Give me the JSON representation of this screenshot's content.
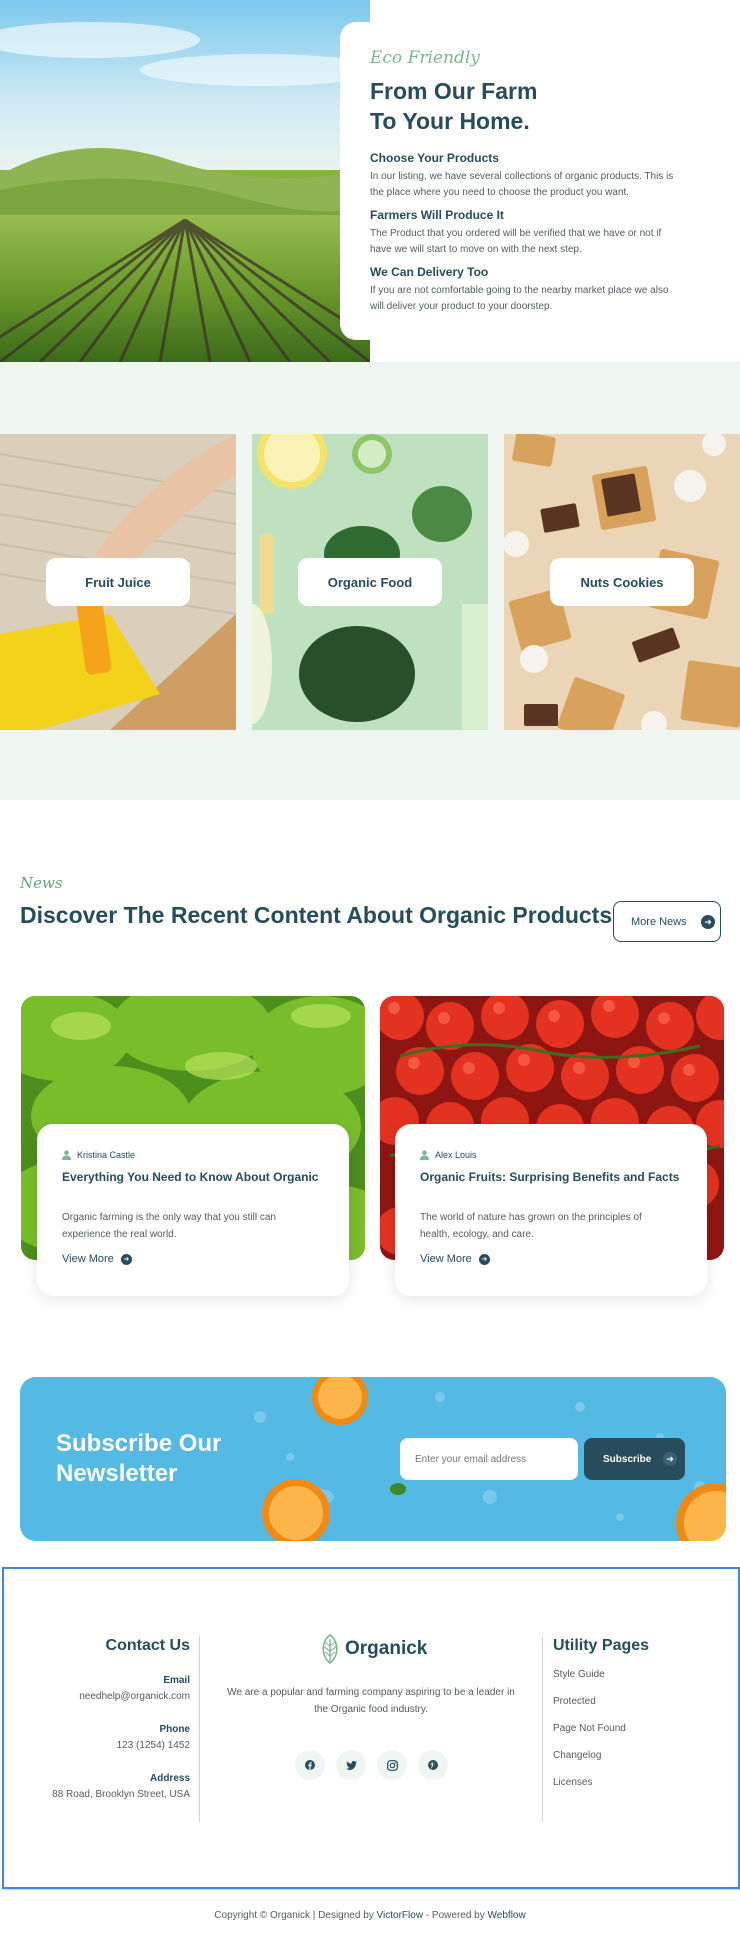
{
  "hero": {
    "tag": "Eco Friendly",
    "title_line1": "From Our Farm",
    "title_line2": "To Your Home.",
    "features": [
      {
        "title": "Choose Your Products",
        "text": "In our listing, we have several collections of organic products. This is the place where you need to choose the product you want."
      },
      {
        "title": "Farmers Will Produce It",
        "text": "The Product that you ordered will be verified that we have or not if have we will start to move on with the next step."
      },
      {
        "title": "We Can Delivery Too",
        "text": "If you are not comfortable going to the nearby market place we also will deliver your product to your doorstep."
      }
    ]
  },
  "categories": [
    {
      "label": "Fruit Juice"
    },
    {
      "label": "Organic Food"
    },
    {
      "label": "Nuts Cookies"
    }
  ],
  "news": {
    "tag": "News",
    "title": "Discover The Recent Content About Organic Products",
    "more_label": "More News",
    "cards": [
      {
        "author": "Kristina Castle",
        "title": "Everything You Need to Know About Organic",
        "text": "Organic farming is the only way that you still can experience the real world.",
        "more": "View More"
      },
      {
        "author": "Alex Louis",
        "title": "Organic Fruits: Surprising Benefits and Facts",
        "text": "The world of nature has grown on the principles of health, ecology, and care.",
        "more": "View More"
      }
    ]
  },
  "newsletter": {
    "title": "Subscribe Our Newsletter",
    "placeholder": "Enter your email address",
    "button": "Subscribe"
  },
  "footer": {
    "contact_heading": "Contact Us",
    "email_label": "Email",
    "email_value": "needhelp@organick.com",
    "phone_label": "Phone",
    "phone_value": "123 (1254) 1452",
    "address_label": "Address",
    "address_value": "88 Road, Brooklyn Street, USA",
    "brand": "Organick",
    "description": "We are a popular and farming company aspiring to be a leader in the Organic food industry.",
    "social": [
      "facebook-icon",
      "twitter-icon",
      "instagram-icon",
      "pinterest-icon"
    ],
    "utility_heading": "Utility Pages",
    "utility_links": [
      "Style Guide",
      "Protected",
      "Page Not Found",
      "Changelog",
      "Licenses"
    ]
  },
  "copyright": {
    "prefix": "Copyright © Organick | Designed by",
    "designer": "VictorFlow",
    "middle": "- Powered by",
    "platform": "Webflow"
  },
  "colors": {
    "primary": "#274c5b",
    "accent_green": "#7eb693",
    "newsletter_blue": "#52b7e1",
    "band": "#eff6f1"
  }
}
